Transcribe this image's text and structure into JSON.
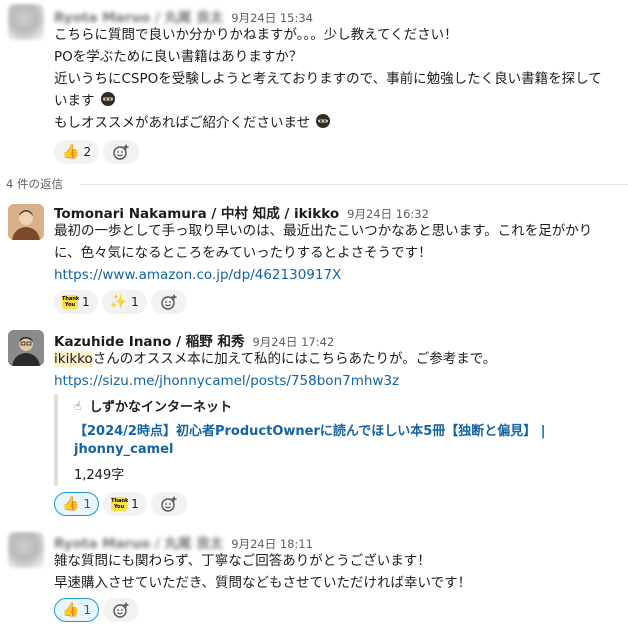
{
  "messages": [
    {
      "author": "Ryota Maruo / 丸尾 良太",
      "time": "9月24日 15:34",
      "lines": [
        "こちらに質問で良いか分かりかねますが。。。少し教えてください！",
        "POを学ぶために良い書籍はありますか？",
        "近いうちにCSPOを受験しようと考えておりますので、事前に勉強したく良い書籍を探して",
        "います",
        "もしオススメがあればご紹介くださいませ"
      ],
      "reactions": [
        {
          "emoji": "👍",
          "count": "2"
        }
      ]
    },
    {
      "author": "Tomonari Nakamura / 中村 知成 / ikikko",
      "time": "9月24日 16:32",
      "lines": [
        "最初の一歩として手っ取り早いのは、最近出たこいつかなあと思います。これを足がかり",
        "に、色々気になるところをみていったりするとよさそうです！"
      ],
      "link": "https://www.amazon.co.jp/dp/462130917X",
      "reactions": [
        {
          "emoji": "Thank You",
          "count": "1"
        },
        {
          "emoji": "✨",
          "count": "1"
        }
      ]
    },
    {
      "author": "Kazuhide Inano / 稲野 和秀",
      "time": "9月24日 17:42",
      "mention": "ikikko",
      "text_after_mention": "さんのオススメ本に加えて私的にはこちらあたりが。ご参考まで。",
      "link": "https://sizu.me/jhonnycamel/posts/758bon7mhw3z",
      "preview": {
        "site": "しずかなインターネット",
        "title": "【2024/2時点】初心者ProductOwnerに読んでほしい本5冊【独断と偏見】 |",
        "author": "jhonny_camel",
        "meta": "1,249字"
      },
      "reactions": [
        {
          "emoji": "👍",
          "count": "1"
        },
        {
          "emoji": "Thank You",
          "count": "1"
        }
      ]
    },
    {
      "author": "Ryota Maruo / 丸尾 良太",
      "time": "9月24日 18:11",
      "lines": [
        "雑な質問にも関わらず、丁寧なご回答ありがとうございます！",
        "早速購入させていただき、質問などもさせていただければ幸いです！"
      ],
      "reactions": [
        {
          "emoji": "👍",
          "count": "1"
        }
      ]
    }
  ],
  "thread": {
    "reply_count_label": "4 件の返信"
  },
  "thanks_text": "Thank You",
  "icons": {
    "add_reaction": "add-reaction-icon",
    "site": "hand-icon"
  }
}
